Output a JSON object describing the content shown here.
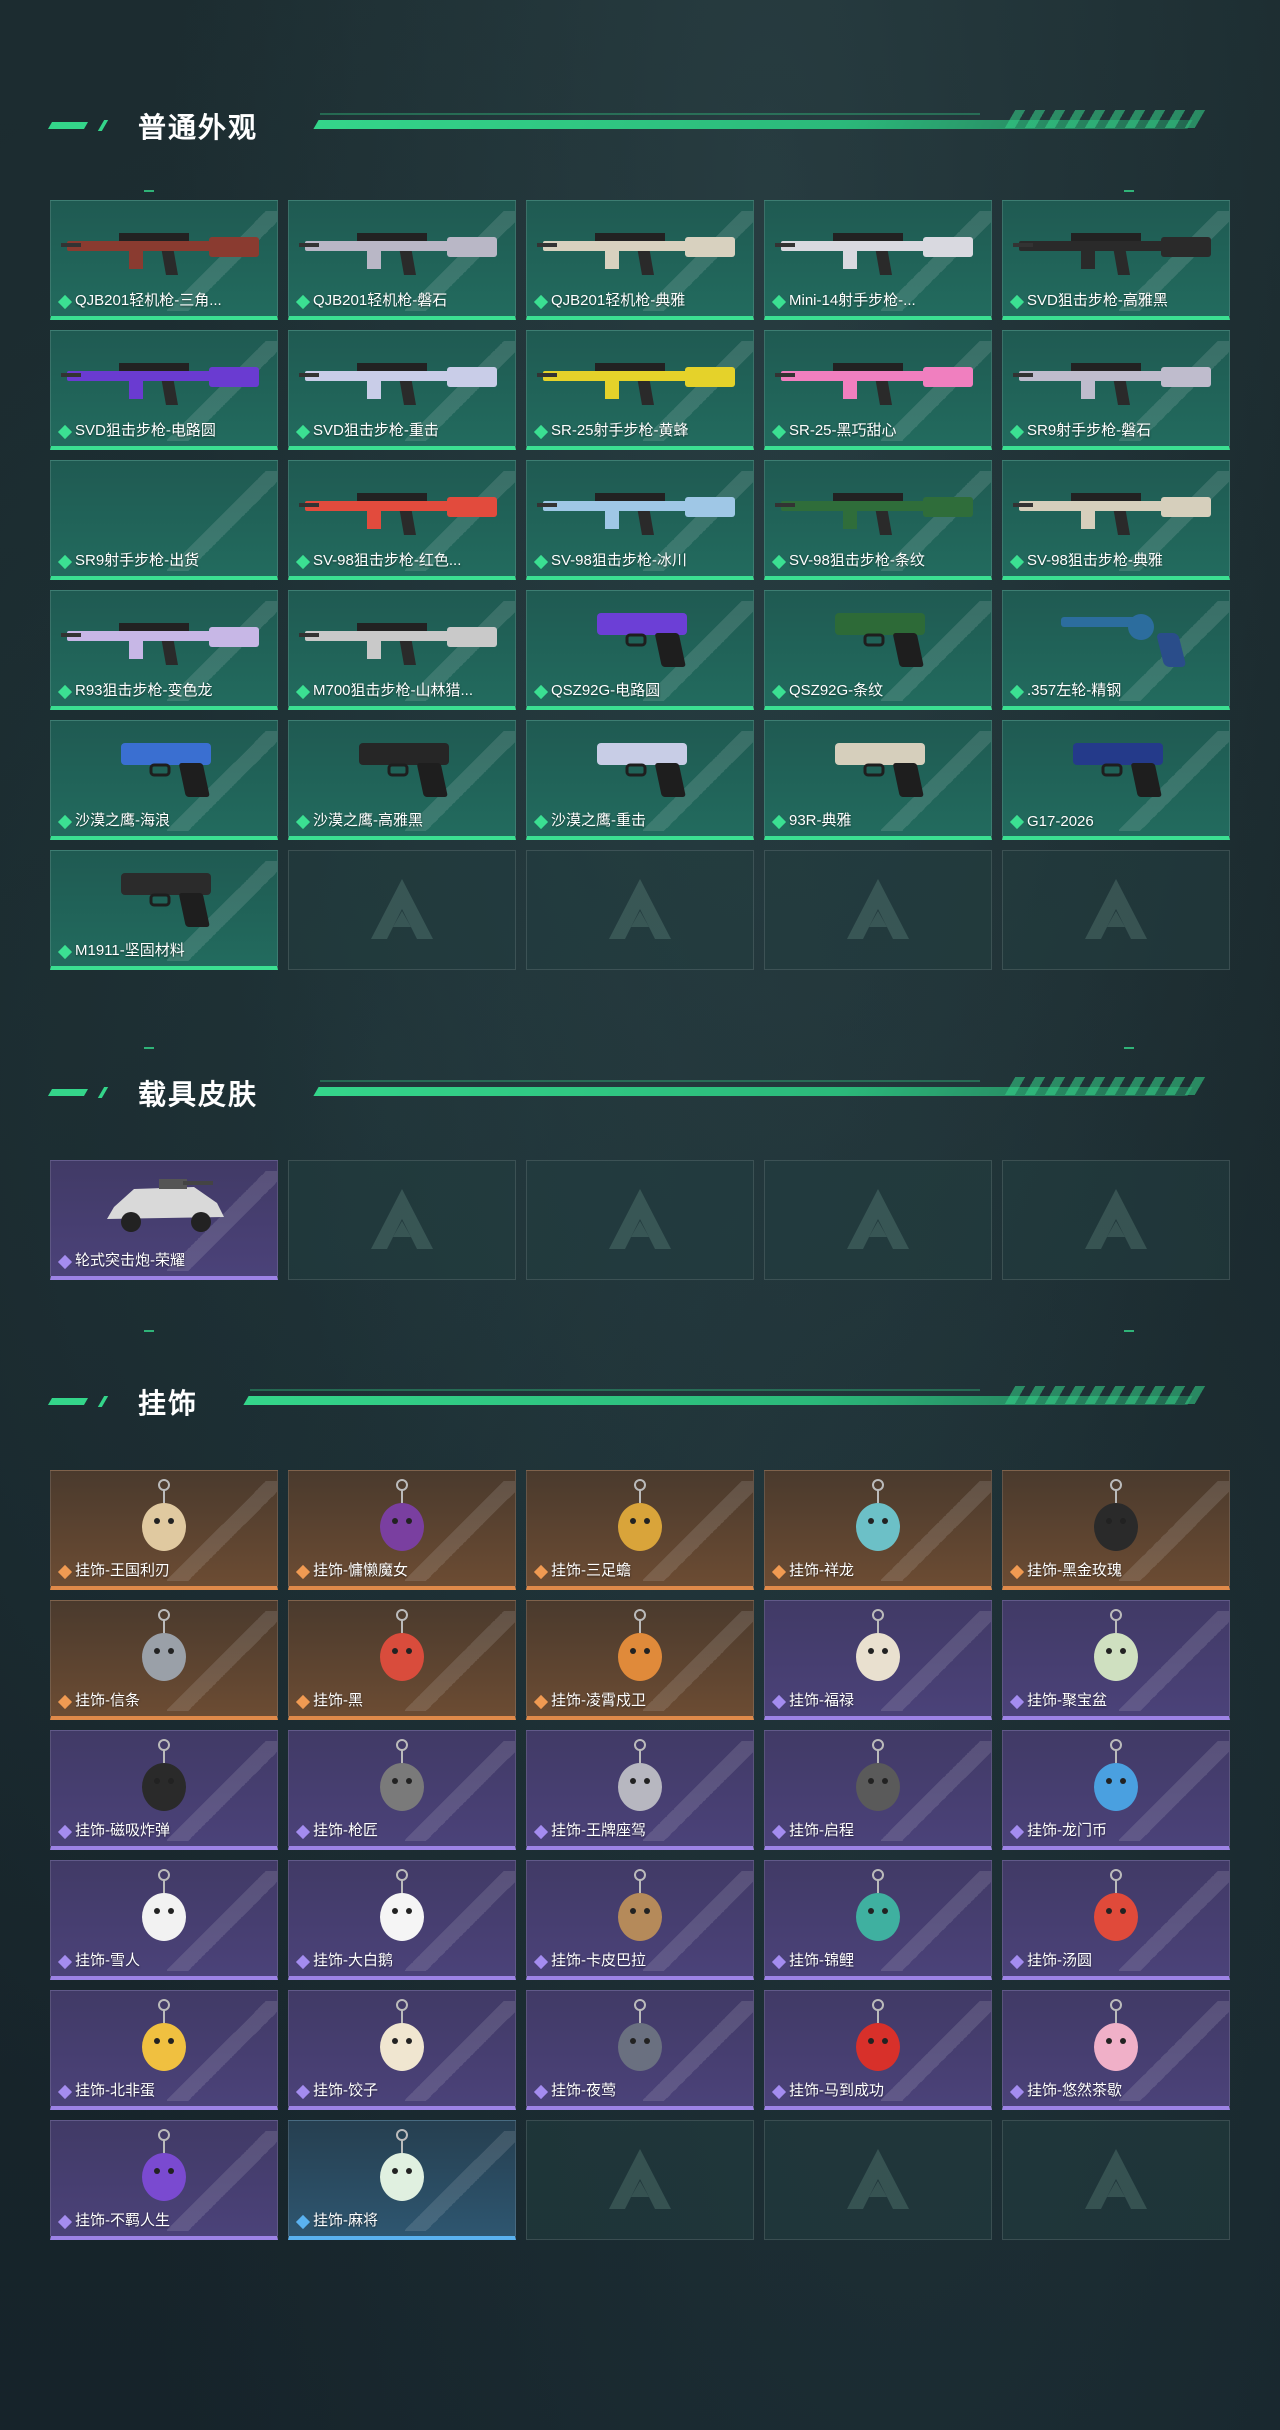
{
  "sections": {
    "weapons": {
      "title": "普通外观",
      "items": [
        {
          "label": "QJB201轻机枪-三角...",
          "rarity": "green",
          "icon": "rifle-icon",
          "tint": "#8a3b30"
        },
        {
          "label": "QJB201轻机枪-磐石",
          "rarity": "green",
          "icon": "rifle-icon",
          "tint": "#b9b7c6"
        },
        {
          "label": "QJB201轻机枪-典雅",
          "rarity": "green",
          "icon": "rifle-icon",
          "tint": "#d8d1bf"
        },
        {
          "label": "Mini-14射手步枪-...",
          "rarity": "green",
          "icon": "rifle-icon",
          "tint": "#d9d9e0"
        },
        {
          "label": "SVD狙击步枪-高雅黑",
          "rarity": "green",
          "icon": "rifle-icon",
          "tint": "#2a2a2a"
        },
        {
          "label": "SVD狙击步枪-电路圆",
          "rarity": "green",
          "icon": "rifle-icon",
          "tint": "#6a3bd1"
        },
        {
          "label": "SVD狙击步枪-重击",
          "rarity": "green",
          "icon": "rifle-icon",
          "tint": "#c9cde8"
        },
        {
          "label": "SR-25射手步枪-黄蜂",
          "rarity": "green",
          "icon": "rifle-icon",
          "tint": "#e5d22a"
        },
        {
          "label": "SR-25-黑巧甜心",
          "rarity": "green",
          "icon": "rifle-icon",
          "tint": "#f07fbf"
        },
        {
          "label": "SR9射手步枪-磐石",
          "rarity": "green",
          "icon": "rifle-icon",
          "tint": "#bfbccd"
        },
        {
          "label": "SR9射手步枪-出货",
          "rarity": "green",
          "icon": "none",
          "tint": ""
        },
        {
          "label": "SV-98狙击步枪-红色...",
          "rarity": "green",
          "icon": "rifle-icon",
          "tint": "#e24b3d"
        },
        {
          "label": "SV-98狙击步枪-冰川",
          "rarity": "green",
          "icon": "rifle-icon",
          "tint": "#9fc7e6"
        },
        {
          "label": "SV-98狙击步枪-条纹",
          "rarity": "green",
          "icon": "rifle-icon",
          "tint": "#2f6d3a"
        },
        {
          "label": "SV-98狙击步枪-典雅",
          "rarity": "green",
          "icon": "rifle-icon",
          "tint": "#d6cfbc"
        },
        {
          "label": "R93狙击步枪-变色龙",
          "rarity": "green",
          "icon": "rifle-icon",
          "tint": "#c7b7e6"
        },
        {
          "label": "M700狙击步枪-山林猎...",
          "rarity": "green",
          "icon": "rifle-icon",
          "tint": "#c9c9c9"
        },
        {
          "label": "QSZ92G-电路圆",
          "rarity": "green",
          "icon": "pistol-icon",
          "tint": "#6c3fd6"
        },
        {
          "label": "QSZ92G-条纹",
          "rarity": "green",
          "icon": "pistol-icon",
          "tint": "#2d6a37"
        },
        {
          "label": ".357左轮-精钢",
          "rarity": "green",
          "icon": "revolver-icon",
          "tint": "#2c6d9e"
        },
        {
          "label": "沙漠之鹰-海浪",
          "rarity": "green",
          "icon": "pistol-icon",
          "tint": "#3a6fd1"
        },
        {
          "label": "沙漠之鹰-高雅黑",
          "rarity": "green",
          "icon": "pistol-icon",
          "tint": "#262626"
        },
        {
          "label": "沙漠之鹰-重击",
          "rarity": "green",
          "icon": "pistol-icon",
          "tint": "#c8cde6"
        },
        {
          "label": "93R-典雅",
          "rarity": "green",
          "icon": "pistol-icon",
          "tint": "#d6cfbc"
        },
        {
          "label": "G17-2026",
          "rarity": "green",
          "icon": "pistol-icon",
          "tint": "#243a8a"
        },
        {
          "label": "M1911-坚固材料",
          "rarity": "green",
          "icon": "pistol-icon",
          "tint": "#2b2b2b"
        }
      ]
    },
    "vehicles": {
      "title": "载具皮肤",
      "items": [
        {
          "label": "轮式突击炮-荣耀",
          "rarity": "purple",
          "icon": "vehicle-icon",
          "tint": "#d9d9d9"
        }
      ]
    },
    "charms": {
      "title": "挂饰",
      "items": [
        {
          "label": "挂饰-王国利刃",
          "rarity": "orange",
          "icon": "charm-icon",
          "tint": "#e0c9a0"
        },
        {
          "label": "挂饰-慵懒魔女",
          "rarity": "orange",
          "icon": "charm-icon",
          "tint": "#7a3fa0"
        },
        {
          "label": "挂饰-三足蟾",
          "rarity": "orange",
          "icon": "charm-icon",
          "tint": "#d9a43a"
        },
        {
          "label": "挂饰-祥龙",
          "rarity": "orange",
          "icon": "charm-icon",
          "tint": "#6cc0c7"
        },
        {
          "label": "挂饰-黑金玫瑰",
          "rarity": "orange",
          "icon": "charm-icon",
          "tint": "#2a2a2a"
        },
        {
          "label": "挂饰-信条",
          "rarity": "orange",
          "icon": "charm-icon",
          "tint": "#9aa0a8"
        },
        {
          "label": "挂饰-黑",
          "rarity": "orange",
          "icon": "charm-icon",
          "tint": "#d94c3c"
        },
        {
          "label": "挂饰-凌霄戍卫",
          "rarity": "orange",
          "icon": "charm-icon",
          "tint": "#e08a3a"
        },
        {
          "label": "挂饰-福禄",
          "rarity": "purple",
          "icon": "charm-icon",
          "tint": "#e9e0cf"
        },
        {
          "label": "挂饰-聚宝盆",
          "rarity": "purple",
          "icon": "charm-icon",
          "tint": "#cfe0c0"
        },
        {
          "label": "挂饰-磁吸炸弹",
          "rarity": "purple",
          "icon": "charm-icon",
          "tint": "#2a2a2a"
        },
        {
          "label": "挂饰-枪匠",
          "rarity": "purple",
          "icon": "charm-icon",
          "tint": "#7a7a7a"
        },
        {
          "label": "挂饰-王牌座驾",
          "rarity": "purple",
          "icon": "charm-icon",
          "tint": "#b7b7c0"
        },
        {
          "label": "挂饰-启程",
          "rarity": "purple",
          "icon": "charm-icon",
          "tint": "#5a5a5a"
        },
        {
          "label": "挂饰-龙门币",
          "rarity": "purple",
          "icon": "charm-icon",
          "tint": "#4aa0e0"
        },
        {
          "label": "挂饰-雪人",
          "rarity": "purple",
          "icon": "charm-icon",
          "tint": "#f2f2f2"
        },
        {
          "label": "挂饰-大白鹅",
          "rarity": "purple",
          "icon": "charm-icon",
          "tint": "#f5f5f5"
        },
        {
          "label": "挂饰-卡皮巴拉",
          "rarity": "purple",
          "icon": "charm-icon",
          "tint": "#b58a5a"
        },
        {
          "label": "挂饰-锦鲤",
          "rarity": "purple",
          "icon": "charm-icon",
          "tint": "#3fb0a0"
        },
        {
          "label": "挂饰-汤圆",
          "rarity": "purple",
          "icon": "charm-icon",
          "tint": "#e04a3a"
        },
        {
          "label": "挂饰-北非蛋",
          "rarity": "purple",
          "icon": "charm-icon",
          "tint": "#f0c040"
        },
        {
          "label": "挂饰-饺子",
          "rarity": "purple",
          "icon": "charm-icon",
          "tint": "#f0e6d0"
        },
        {
          "label": "挂饰-夜莺",
          "rarity": "purple",
          "icon": "charm-icon",
          "tint": "#6a7080"
        },
        {
          "label": "挂饰-马到成功",
          "rarity": "purple",
          "icon": "charm-icon",
          "tint": "#d8302a"
        },
        {
          "label": "挂饰-悠然茶歇",
          "rarity": "purple",
          "icon": "charm-icon",
          "tint": "#f0b0c8"
        },
        {
          "label": "挂饰-不羁人生",
          "rarity": "purple",
          "icon": "charm-icon",
          "tint": "#7a4ad0"
        },
        {
          "label": "挂饰-麻将",
          "rarity": "blue",
          "icon": "charm-icon",
          "tint": "#e0f0e0"
        }
      ]
    }
  }
}
